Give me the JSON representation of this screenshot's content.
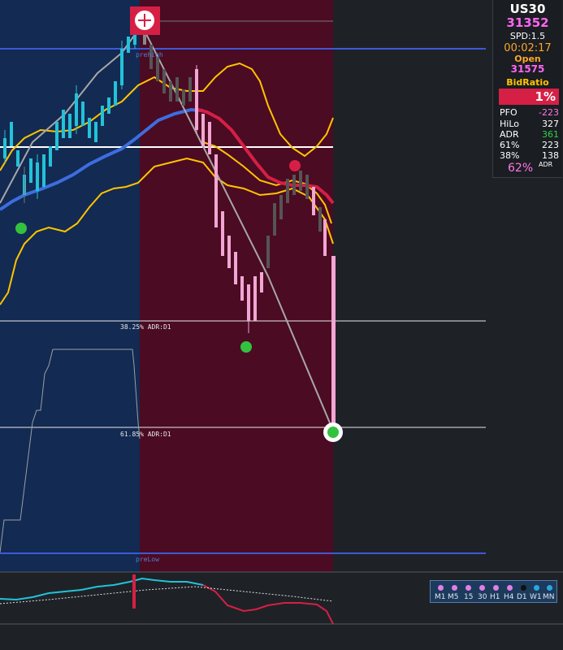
{
  "symbol": "US30",
  "price": "31352",
  "spread": "SPD:1.5",
  "timer": "00:02:17",
  "open_label": "Open",
  "open_value": "31575",
  "bidratio_label": "BidRatio",
  "bidratio_value": "1%",
  "stats": [
    {
      "label": "PFO",
      "value": "-223",
      "color": "#ff77e8"
    },
    {
      "label": "HiLo",
      "value": "327",
      "color": "#ffffff"
    },
    {
      "label": "ADR",
      "value": "361",
      "color": "#33d04a"
    },
    {
      "label": "61%",
      "value": "223",
      "color": "#ffffff"
    },
    {
      "label": "38%",
      "value": "138",
      "color": "#ffffff"
    }
  ],
  "adr_percent": "62%",
  "adr_suffix": "ADR",
  "levels": {
    "prehigh": "prehigh",
    "prelow": "preLow",
    "adr38": "38.25% ADR:D1",
    "adr61": "61.85% ADR:D1"
  },
  "timeframes": [
    "M1",
    "M5",
    "15",
    "30",
    "H1",
    "H4",
    "D1",
    "W1",
    "MN"
  ],
  "active_timeframes": [
    "D1",
    "W1"
  ],
  "colors": {
    "prior_session": "#132a52",
    "current_session": "#4b0b22",
    "background": "#1e2227",
    "bull": "#23c2d8",
    "bear_pink": "#f2a6d3",
    "ma_blue": "#3d6de0",
    "ma_red": "#d61f45",
    "band_yellow": "#ffc400",
    "price_magenta": "#ff66f2",
    "timer_orange": "#ffa726"
  }
}
